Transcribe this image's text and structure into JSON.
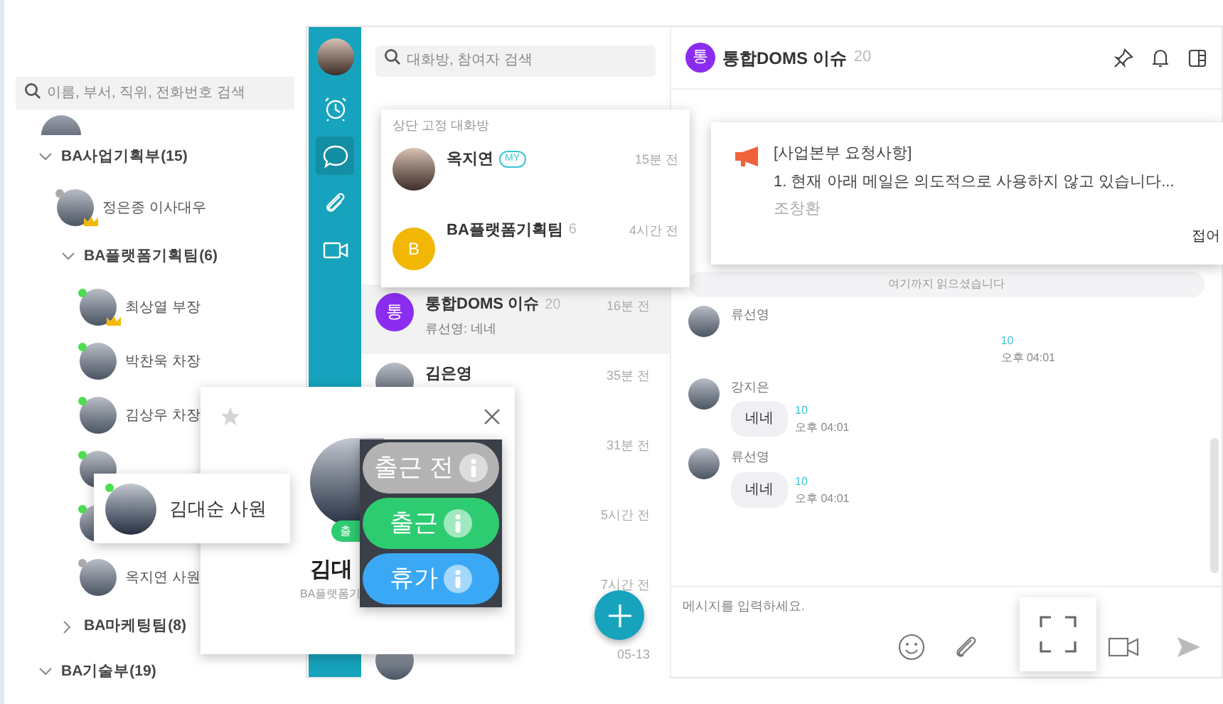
{
  "org_panel": {
    "search": {
      "placeholder": "이름, 부서, 직위, 전화번호 검색"
    },
    "tree": [
      {
        "kind": "group",
        "label": "BA사업기획부(15)",
        "expanded": true,
        "children": [
          {
            "kind": "person",
            "label": "정은종 이사대우",
            "leader": true,
            "online": false
          },
          {
            "kind": "group",
            "label": "BA플랫폼기획팀(6)",
            "expanded": true,
            "children": [
              {
                "kind": "person",
                "label": "최상열 부장",
                "leader": true,
                "online": true
              },
              {
                "kind": "person",
                "label": "박찬욱 차장",
                "leader": false,
                "online": true
              },
              {
                "kind": "person",
                "label": "김상우 차장",
                "leader": false,
                "online": true
              },
              {
                "kind": "covered",
                "online": true
              },
              {
                "kind": "covered",
                "online": true
              },
              {
                "kind": "person",
                "label": "옥지연 사원",
                "leader": false,
                "online": false
              }
            ]
          },
          {
            "kind": "group",
            "label": "BA마케팅팀(8)",
            "expanded": false
          }
        ]
      },
      {
        "kind": "group",
        "label": "BA기술부(19)",
        "expanded": true
      }
    ]
  },
  "nav": [
    {
      "kind": "profile",
      "selected": false
    },
    {
      "kind": "clock",
      "selected": false
    },
    {
      "kind": "chat",
      "selected": true
    },
    {
      "kind": "clip",
      "selected": false
    },
    {
      "kind": "video",
      "selected": false
    }
  ],
  "chat_list": {
    "search": {
      "placeholder": "대화방, 참여자 검색"
    },
    "rows": [
      {
        "avatar": "통",
        "name": "통합DOMS 이슈",
        "count": "20",
        "time": "16분 전",
        "preview": "류선영: 네네",
        "selected": true
      },
      {
        "name": "김은영",
        "time": "35분 전",
        "selected": false
      },
      {
        "time": "31분 전",
        "selected": false
      },
      {
        "time": "5시간 전",
        "selected": false
      },
      {
        "time": "7시간 전",
        "selected": false
      },
      {
        "time": "05-13",
        "selected": false
      }
    ]
  },
  "chat": {
    "avatar": "통",
    "title": "통합DOMS 이슈",
    "count": "20",
    "messages": [
      {
        "kind": "divider",
        "text": "여기까지 읽으셨습니다"
      },
      {
        "kind": "message",
        "sender": "류선영",
        "unread": "10",
        "time": "오후 04:01"
      },
      {
        "kind": "message",
        "sender": "강지은",
        "text": "네네",
        "unread": "10",
        "time": "오후 04:01"
      },
      {
        "kind": "message",
        "sender": "류선영",
        "text": "네네",
        "unread": "10",
        "time": "오후 04:01"
      }
    ],
    "input": {
      "placeholder": "메시지를 입력하세요."
    }
  },
  "pinned_popup": {
    "heading": "상단 고정 대화방",
    "items": [
      {
        "kind": "photo",
        "name": "옥지연",
        "badge": "MY",
        "time": "15분 전"
      },
      {
        "kind": "letter",
        "avatar": "B",
        "name": "BA플랫폼기획팀",
        "count": "6",
        "time": "4시간 전"
      }
    ]
  },
  "notice_popup": {
    "title": "[사업본부 요청사항]",
    "body": "1. 현재 아래 메일은 의도적으로 사용하지 않고 있습니다...",
    "author": "조창환",
    "fold": "접어"
  },
  "profile_card": {
    "badge": "출",
    "name": "김대",
    "dept": "BA플랫폼기"
  },
  "name_tooltip": {
    "name": "김대순 사원",
    "online": true
  },
  "status_options": [
    {
      "label": "출근 전",
      "color": "#b3b3b3"
    },
    {
      "label": "출근",
      "color": "#2ecc71"
    },
    {
      "label": "휴가",
      "color": "#3aa8f5"
    }
  ]
}
